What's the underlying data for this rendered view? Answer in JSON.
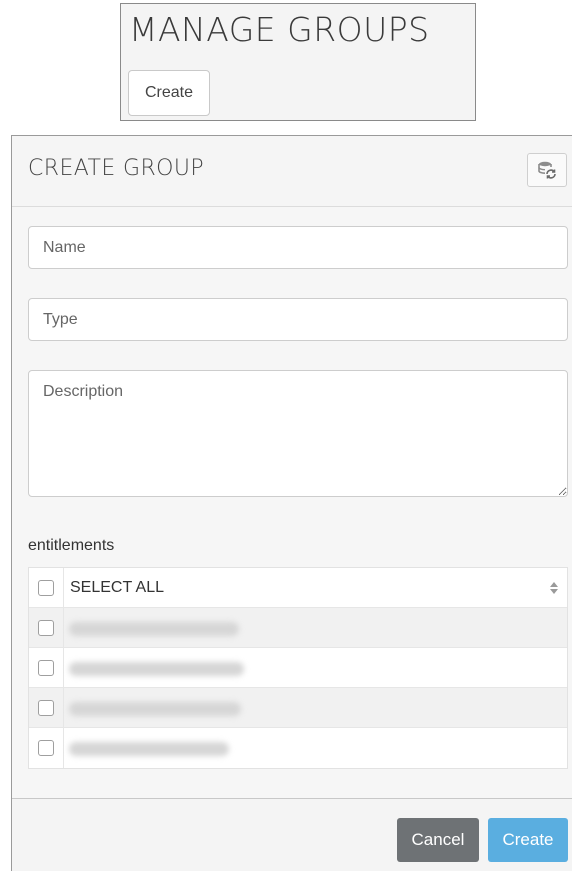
{
  "manage": {
    "title": "MANAGE GROUPS",
    "create_label": "Create"
  },
  "modal": {
    "title": "CREATE GROUP",
    "refresh_icon": "db-refresh-icon"
  },
  "form": {
    "name_placeholder": "Name",
    "type_placeholder": "Type",
    "description_placeholder": "Description"
  },
  "entitlements": {
    "label": "entitlements",
    "select_all_label": "SELECT ALL",
    "sort_icon": "sort-icon",
    "rows_count_visible": 4
  },
  "footer": {
    "cancel_label": "Cancel",
    "create_label": "Create"
  },
  "colors": {
    "primary": "#5aaee0",
    "secondary": "#6e7275"
  }
}
